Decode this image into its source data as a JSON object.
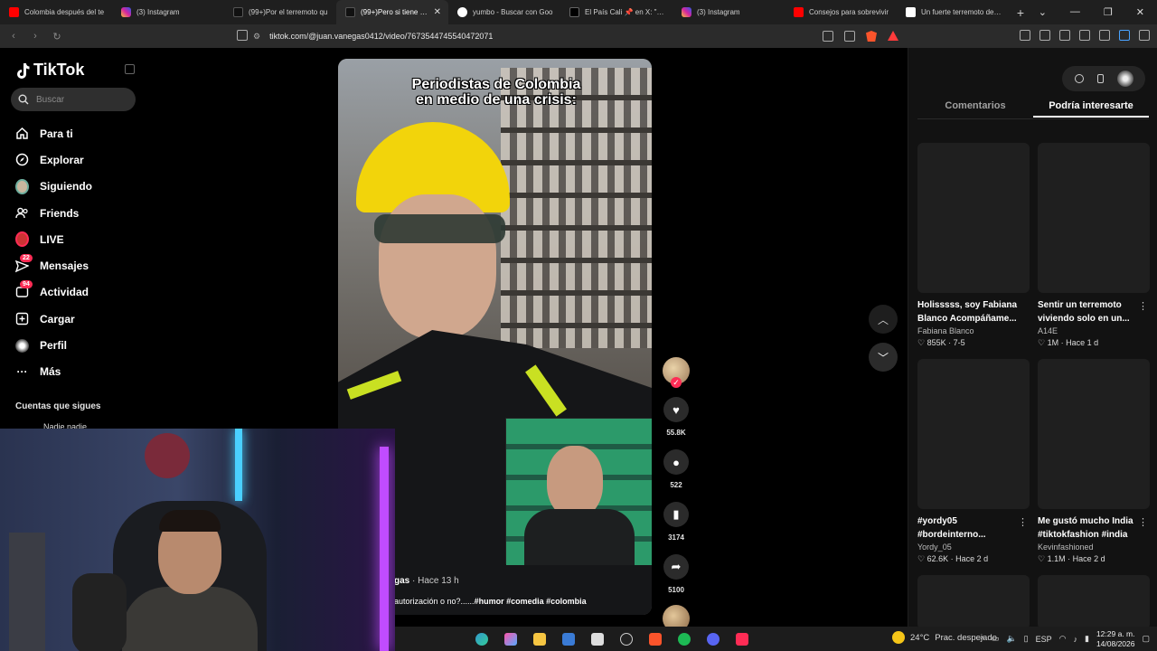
{
  "browser": {
    "tabs": [
      {
        "label": "Colombia después del te",
        "favicon": "youtube-icon"
      },
      {
        "label": "(3) Instagram",
        "favicon": "instagram-icon"
      },
      {
        "label": "(99+)Por el terremoto qu",
        "favicon": "tiktok-icon"
      },
      {
        "label": "(99+)Pero si tiene aut",
        "favicon": "tiktok-icon",
        "active": true
      },
      {
        "label": "yumbo - Buscar con Goo",
        "favicon": "google-icon"
      },
      {
        "label": "El País Cali 📌 en X: \"📌",
        "favicon": "x-icon"
      },
      {
        "label": "(3) Instagram",
        "favicon": "instagram-icon"
      },
      {
        "label": "Consejos para sobrevivir",
        "favicon": "youtube-icon"
      },
      {
        "label": "Un fuerte terremoto de m",
        "favicon": "elpais-icon"
      }
    ],
    "url": "tiktok.com/@juan.vanegas0412/video/7673544745540472071"
  },
  "sidebar": {
    "logo": "TikTok",
    "search_placeholder": "Buscar",
    "items": [
      {
        "label": "Para ti",
        "icon": "home-icon"
      },
      {
        "label": "Explorar",
        "icon": "compass-icon"
      },
      {
        "label": "Siguiendo",
        "icon": "following-avatar-icon"
      },
      {
        "label": "Friends",
        "icon": "friends-icon"
      },
      {
        "label": "LIVE",
        "icon": "live-icon"
      },
      {
        "label": "Mensajes",
        "icon": "messages-icon",
        "badge": "22"
      },
      {
        "label": "Actividad",
        "icon": "activity-icon",
        "badge": "94"
      },
      {
        "label": "Cargar",
        "icon": "upload-icon"
      },
      {
        "label": "Perfil",
        "icon": "profile-icon"
      },
      {
        "label": "Más",
        "icon": "more-icon"
      }
    ],
    "following_title": "Cuentas que sigues",
    "following_user": "Nadie nadie"
  },
  "video": {
    "overlay_text": "Periodistas de Colombia en medio de una crisis:",
    "author_fragment": "gas",
    "time": "Hace 13 h",
    "description_fragment": "autorización o no?......",
    "hashtags": "#humor #comedia #colombia"
  },
  "actions": {
    "likes": "55.8K",
    "comments": "522",
    "saves": "3174",
    "shares": "5100"
  },
  "right_panel": {
    "tabs": [
      "Comentarios",
      "Podría interesarte"
    ],
    "active_tab": 1,
    "cards": [
      {
        "title": "Holisssss, soy Fabiana Blanco Acompáñame...",
        "author": "Fabiana Blanco",
        "views": "855K",
        "age": "7-5"
      },
      {
        "title": "Sentir un terremoto viviendo solo en un...",
        "author": "A14E",
        "views": "1M",
        "age": "Hace 1 d"
      },
      {
        "title": "#yordy05 #bordeinterno...",
        "author": "Yordy_05",
        "views": "62.6K",
        "age": "Hace 2 d"
      },
      {
        "title": "Me gustó mucho India #tiktokfashion #india",
        "author": "Kevinfashioned",
        "views": "1.1M",
        "age": "Hace 2 d"
      }
    ]
  },
  "taskbar": {
    "temperature": "24°C",
    "weather": "Prac. despejado",
    "lang": "ESP",
    "time": "12:29 a. m.",
    "date": "14/08/2026"
  },
  "colors": {
    "accent": "#fe2c55",
    "background": "#000000",
    "panel": "#121212"
  }
}
